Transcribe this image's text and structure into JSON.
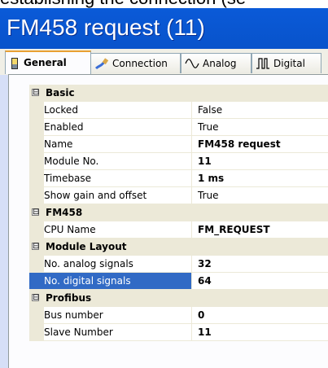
{
  "caption": "establishing the connection (se",
  "window": {
    "title": "FM458 request (11)"
  },
  "tabs": [
    {
      "label": "General",
      "icon": "document-icon",
      "active": true
    },
    {
      "label": "Connection",
      "icon": "cable-icon",
      "active": false
    },
    {
      "label": "Analog",
      "icon": "sine-wave-icon",
      "active": false
    },
    {
      "label": "Digital",
      "icon": "pulse-wave-icon",
      "active": false
    }
  ],
  "grid": {
    "expander_symbol": "⊟",
    "groups": [
      {
        "label": "Basic",
        "rows": [
          {
            "name": "Locked",
            "value": "False",
            "bold": false
          },
          {
            "name": "Enabled",
            "value": "True",
            "bold": false
          },
          {
            "name": "Name",
            "value": "FM458 request",
            "bold": true
          },
          {
            "name": "Module No.",
            "value": "11",
            "bold": true
          },
          {
            "name": "Timebase",
            "value": "1 ms",
            "bold": true
          },
          {
            "name": "Show gain and offset",
            "value": "True",
            "bold": false
          }
        ]
      },
      {
        "label": "FM458",
        "rows": [
          {
            "name": "CPU Name",
            "value": "FM_REQUEST",
            "bold": true
          }
        ]
      },
      {
        "label": "Module Layout",
        "rows": [
          {
            "name": "No. analog signals",
            "value": "32",
            "bold": true
          },
          {
            "name": "No. digital signals",
            "value": "64",
            "bold": true,
            "selected": true
          }
        ]
      },
      {
        "label": "Profibus",
        "rows": [
          {
            "name": "Bus number",
            "value": "0",
            "bold": true
          },
          {
            "name": "Slave Number",
            "value": "11",
            "bold": true
          }
        ]
      }
    ]
  }
}
